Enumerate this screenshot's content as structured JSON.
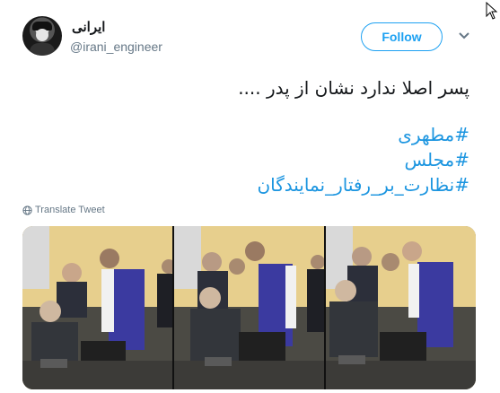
{
  "user": {
    "name": "ایرانی",
    "handle": "@irani_engineer",
    "avatar_icon": "avatar-portrait-icon"
  },
  "follow_label": "Follow",
  "menu_icon": "chevron-down-icon",
  "tweet": {
    "line1": "پسر اصلا ندارد نشان از پدر ....",
    "hashtags": [
      "#مطهری",
      "#مجلس",
      "#نظارت_بر_رفتار_نمایندگان"
    ]
  },
  "translate_label": "Translate Tweet",
  "colors": {
    "accent": "#1da1f2",
    "hashtag": "#1b95e0",
    "muted": "#657786",
    "text": "#14171a"
  },
  "media": {
    "photo_count": 3
  }
}
